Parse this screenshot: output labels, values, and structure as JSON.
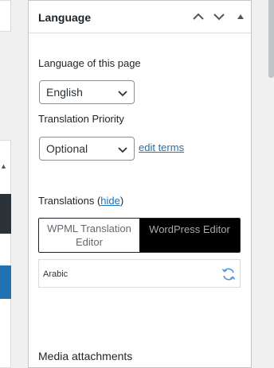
{
  "panel": {
    "title": "Language",
    "language_of_page_label": "Language of this page",
    "language_select_value": "English",
    "translation_priority_label": "Translation Priority",
    "priority_select_value": "Optional",
    "edit_terms_link": "edit terms",
    "translations_label": "Translations (",
    "translations_hide_link": "hide",
    "translations_close_paren": ")",
    "editor_toggle": {
      "option_wpml": "WPML Translation Editor",
      "option_wordpress": "WordPress Editor",
      "selected": "WordPress Editor"
    },
    "translation_language": "Arabic",
    "next_section_title": "Media attachments"
  },
  "icons": {
    "move_up": "chevron-up-icon",
    "move_down": "chevron-down-icon",
    "toggle_panel": "triangle-up-icon",
    "select_arrow": "chevron-down-icon",
    "refresh": "refresh-icon"
  },
  "colors": {
    "link": "#2271b1",
    "selected_toggle_bg": "#000000",
    "admin_dark": "#2c3338",
    "admin_blue": "#2271b1"
  }
}
